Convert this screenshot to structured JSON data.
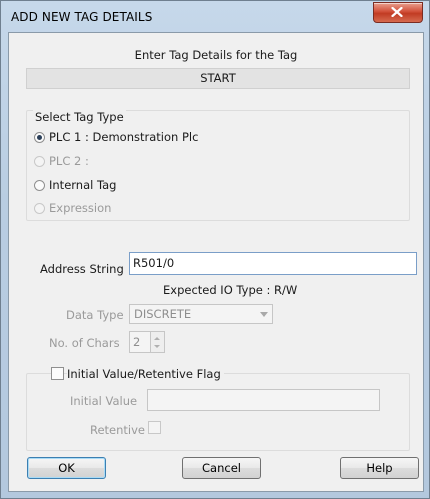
{
  "window": {
    "title": "ADD NEW TAG DETAILS"
  },
  "header": {
    "instruction": "Enter Tag Details for the Tag",
    "tag_name": "START"
  },
  "tag_type": {
    "group_label": "Select Tag Type",
    "options": [
      {
        "label": "PLC 1 : Demonstration  Plc",
        "checked": true,
        "enabled": true
      },
      {
        "label": "PLC 2 :",
        "checked": false,
        "enabled": false
      },
      {
        "label": "Internal Tag",
        "checked": false,
        "enabled": true
      },
      {
        "label": "Expression",
        "checked": false,
        "enabled": false
      }
    ]
  },
  "address": {
    "label": "Address String",
    "value": "R501/0",
    "expected_io": "Expected IO Type : R/W"
  },
  "data_type": {
    "label": "Data Type",
    "value": "DISCRETE"
  },
  "num_chars": {
    "label": "No. of Chars",
    "value": "2"
  },
  "initial_value_group": {
    "label": "Initial Value/Retentive Flag",
    "initial_value_label": "Initial Value",
    "initial_value": "",
    "retentive_label": "Retentive"
  },
  "buttons": {
    "ok": "OK",
    "cancel": "Cancel",
    "help": "Help"
  },
  "colors": {
    "title_gradient": "#b9cde2",
    "close_button": "#c13b23",
    "default_button_border": "#3c7fb1"
  }
}
